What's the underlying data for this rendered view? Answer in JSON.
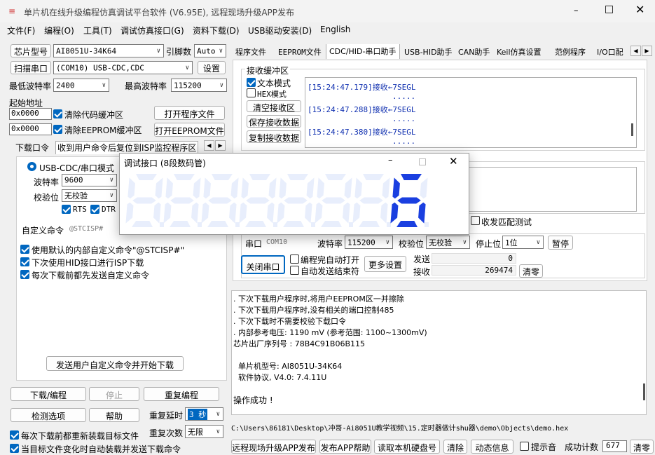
{
  "window": {
    "title": "单片机在线升级编程仿真调试平台软件 (V6.95E), 远程现场升级APP发布"
  },
  "menu": [
    "文件(F)",
    "编程(O)",
    "工具(T)",
    "调试仿真接口(G)",
    "资料下载(D)",
    "USB驱动安装(D)",
    "English"
  ],
  "left": {
    "chip_btn": "芯片型号",
    "chip_value": "AI8051U-34K64",
    "pin_label": "引脚数",
    "pin_value": "Auto",
    "scan_btn": "扫描串口",
    "port_value": "(COM10) USB-CDC,CDC",
    "settings_btn": "设置",
    "min_baud_label": "最低波特率",
    "min_baud_value": "2400",
    "max_baud_label": "最高波特率",
    "max_baud_value": "115200",
    "start_addr_label": "起始地址",
    "addr1": "0x0000",
    "clear_code": "清除代码缓冲区",
    "open_prog": "打开程序文件",
    "addr2": "0x0000",
    "clear_eeprom": "清除EEPROM缓冲区",
    "open_eeprom": "打开EEPROM文件",
    "tabs": [
      "下载口令",
      "收到用户命令后复位到ISP监控程序区"
    ],
    "mode_label": "USB-CDC/串口模式",
    "baud_label": "波特率",
    "baud_value": "9600",
    "parity_label": "校验位",
    "parity_value": "无校验",
    "rts": "RTS",
    "dtr": "DTR",
    "custom_cmd_label": "自定义命令",
    "custom_cmd_value": "@STCISP#",
    "opt1": "使用默认的内部自定义命令\"@STCISP#\"",
    "opt2": "下次使用HID接口进行ISP下载",
    "opt3": "每次下载前都先发送自定义命令",
    "send_btn": "发送用户自定义命令并开始下载",
    "download_btn": "下载/编程",
    "stop_btn": "停止",
    "reprog_btn": "重复编程",
    "check_btn": "检测选项",
    "help_btn": "帮助",
    "delay_label": "重复延时",
    "delay_value": "3 秒",
    "times_label": "重复次数",
    "times_value": "无限",
    "reload_opt": "每次下载前都重新装载目标文件",
    "auto_opt": "当目标文件变化时自动装载并发送下载命令"
  },
  "right": {
    "tabs": [
      "程序文件",
      "EEPROM文件",
      "CDC/HID-串口助手",
      "USB-HID助手",
      "CAN助手",
      "Keil仿真设置",
      "范例程序",
      "I/O口配"
    ],
    "recv_title": "接收缓冲区",
    "text_mode": "文本模式",
    "hex_mode": "HEX模式",
    "clear_recv": "清空接收区",
    "save_recv": "保存接收数据",
    "copy_recv": "复制接收数据",
    "recv_lines": [
      {
        "time": "[15:24:47.179]",
        "text": "接收←7SEGL",
        "dots": "....."
      },
      {
        "time": "[15:24:47.288]",
        "text": "接收←7SEGL",
        "dots": "....."
      },
      {
        "time": "[15:24:47.380]",
        "text": "接收←7SEGL",
        "dots": "....."
      }
    ],
    "match_test": "收发匹配测试",
    "port_label": "串口",
    "port_value": "COM10",
    "baud_label": "波特率",
    "baud_value": "115200",
    "parity_label": "校验位",
    "parity_value": "无校验",
    "stop_label": "停止位",
    "stop_value": "1位",
    "pause_btn": "暂停",
    "close_port_btn": "关闭串口",
    "auto_open": "编程完自动打开",
    "auto_end": "自动发送结束符",
    "more_btn": "更多设置",
    "send_label": "发送",
    "send_count": "0",
    "recv_label": "接收",
    "recv_count": "269474",
    "clear_btn": "清零"
  },
  "log": {
    "lines": [
      ". 下次下载用户程序时,将用户EEPROM区一并擦除",
      ". 下次下载用户程序时,没有相关的端口控制485",
      ". 下次下载时不需要校验下载口令",
      ". 内部参考电压: 1190 mV (参考范围: 1100~1300mV)",
      "芯片出厂序列号 : 78B4C91B06B115",
      "",
      "  单片机型号: AI8051U-34K64",
      "  软件协议, V4.0: 7.4.11U",
      "",
      "操作成功 !"
    ],
    "path": "C:\\Users\\86181\\Desktop\\冲哥-Ai8051U教学视频\\15.定时器做计shu器\\demo\\Objects\\demo.hex"
  },
  "bottom": {
    "b1": "远程现场升级APP发布",
    "b2": "发布APP帮助",
    "b3": "读取本机硬盘号",
    "b4": "清除",
    "b5": "动态信息",
    "beep": "提示音",
    "success_label": "成功计数",
    "success_count": "677",
    "clear": "清零"
  },
  "popup": {
    "title": "调试接口 (8段数码管)",
    "digits": [
      "8",
      "8",
      "8",
      "8",
      "8",
      "8",
      "8",
      "6"
    ],
    "lit": [
      false,
      false,
      false,
      false,
      false,
      false,
      false,
      true
    ],
    "colors": {
      "on": "#1a3fe0",
      "off": "#e8eefc"
    }
  }
}
